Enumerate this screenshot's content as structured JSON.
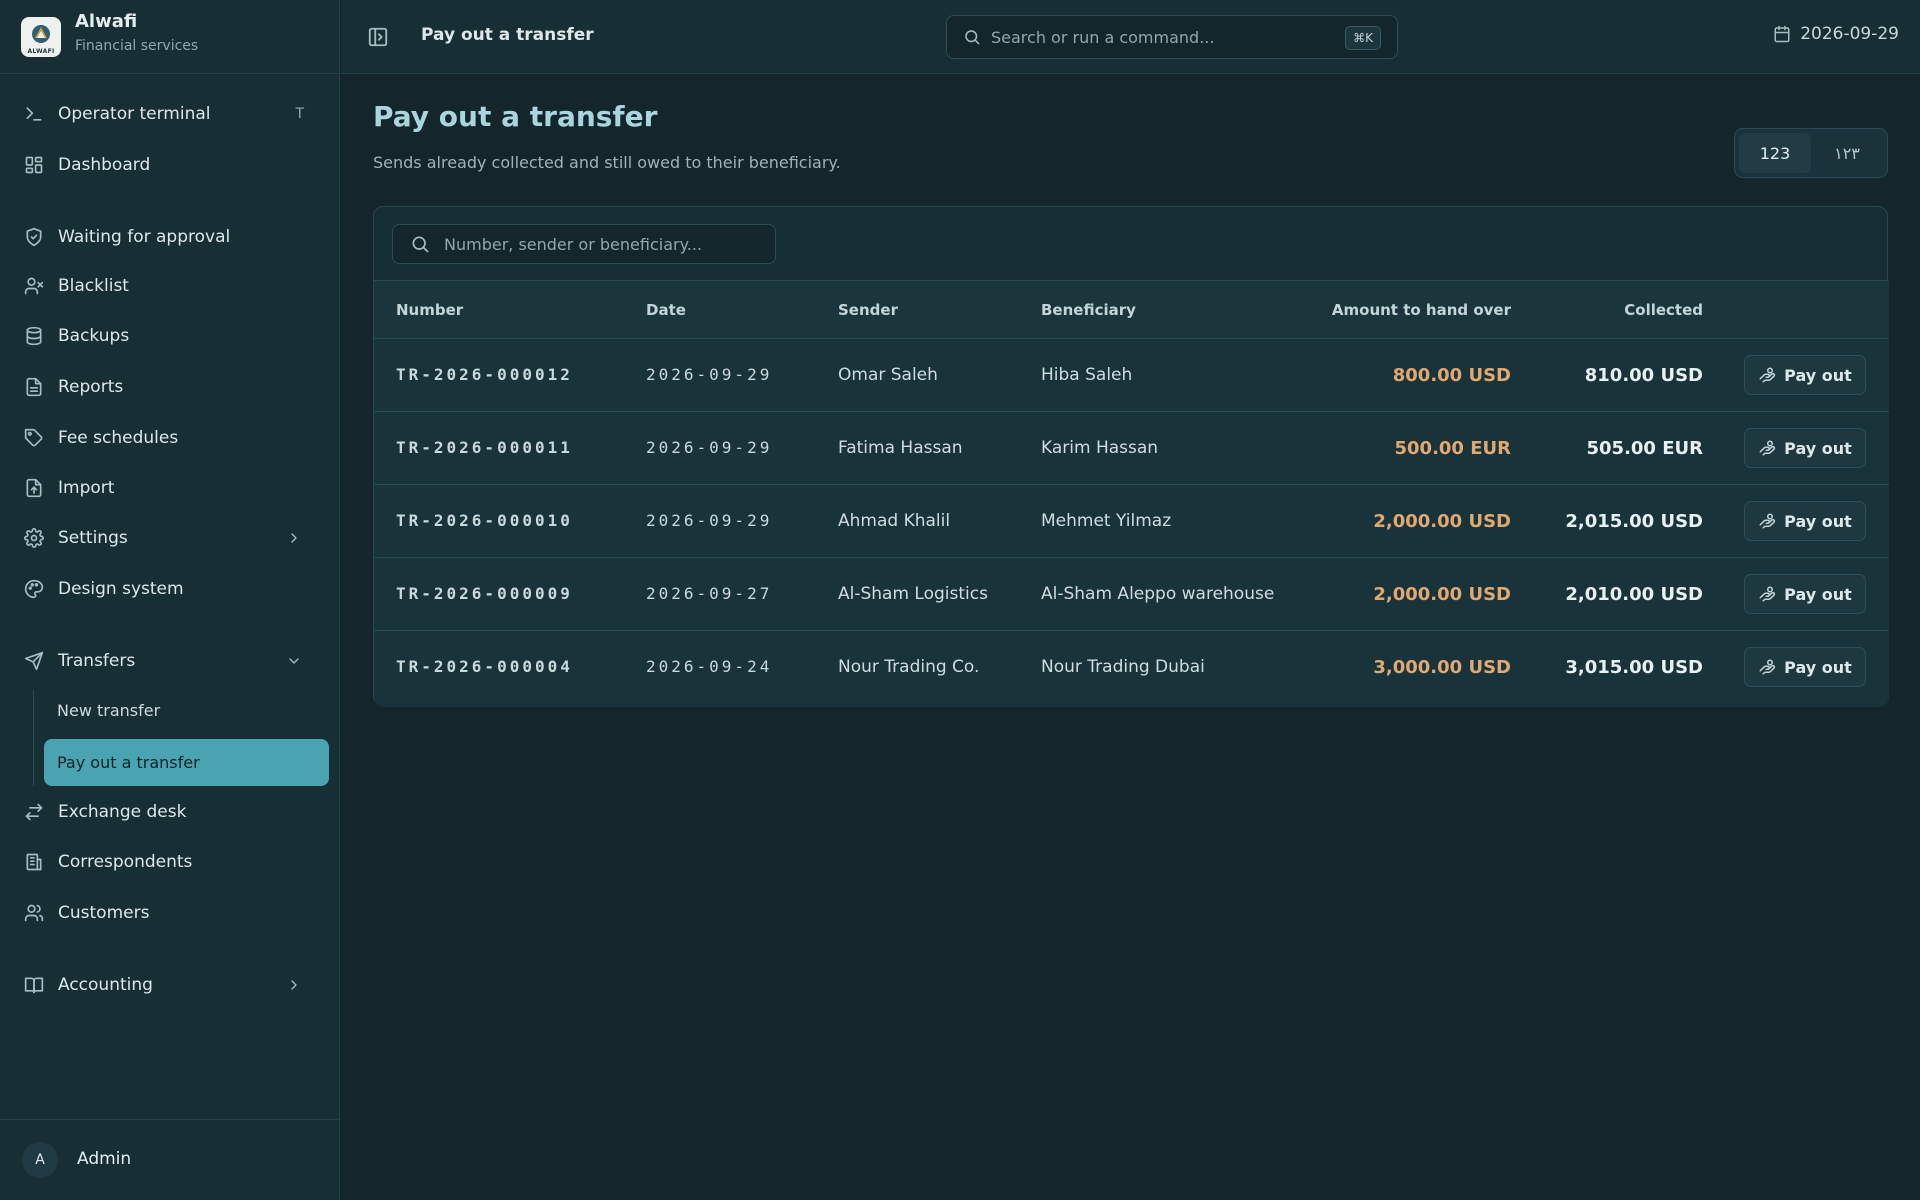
{
  "brand": {
    "name": "Alwafi",
    "subtitle": "Financial services",
    "logo_text": "ALWAFI"
  },
  "sidebar": {
    "items": [
      {
        "label": "Operator terminal",
        "icon": "terminal-icon",
        "shortcut": "T"
      },
      {
        "label": "Dashboard",
        "icon": "dashboard-icon"
      },
      {
        "label": "Waiting for approval",
        "icon": "shield-check-icon"
      },
      {
        "label": "Blacklist",
        "icon": "user-x-icon"
      },
      {
        "label": "Backups",
        "icon": "database-icon"
      },
      {
        "label": "Reports",
        "icon": "file-text-icon"
      },
      {
        "label": "Fee schedules",
        "icon": "tag-icon"
      },
      {
        "label": "Import",
        "icon": "file-import-icon"
      },
      {
        "label": "Settings",
        "icon": "gear-icon"
      },
      {
        "label": "Design system",
        "icon": "palette-icon"
      },
      {
        "label": "Transfers",
        "icon": "send-icon"
      },
      {
        "label": "Exchange desk",
        "icon": "arrows-exchange-icon"
      },
      {
        "label": "Correspondents",
        "icon": "building-icon"
      },
      {
        "label": "Customers",
        "icon": "users-icon"
      },
      {
        "label": "Accounting",
        "icon": "book-icon"
      }
    ],
    "transfers_sub": [
      {
        "label": "New transfer"
      },
      {
        "label": "Pay out a transfer",
        "active": true
      }
    ]
  },
  "user": {
    "initial": "A",
    "name": "Admin"
  },
  "topbar": {
    "title": "Pay out a transfer",
    "search_placeholder": "Search or run a command...",
    "shortcut": "⌘K",
    "date": "2026-09-29"
  },
  "page": {
    "title": "Pay out a transfer",
    "subtitle": "Sends already collected and still owed to their beneficiary.",
    "number_format": [
      "123",
      "١٢٣"
    ],
    "filter_placeholder": "Number, sender or beneficiary..."
  },
  "table": {
    "headers": {
      "number": "Number",
      "date": "Date",
      "sender": "Sender",
      "beneficiary": "Beneficiary",
      "amount": "Amount to hand over",
      "collected": "Collected"
    },
    "action_label": "Pay out",
    "rows": [
      {
        "number": "TR-2026-000012",
        "date": "2026-09-29",
        "sender": "Omar Saleh",
        "beneficiary": "Hiba Saleh",
        "amount": "800.00 USD",
        "collected": "810.00 USD"
      },
      {
        "number": "TR-2026-000011",
        "date": "2026-09-29",
        "sender": "Fatima Hassan",
        "beneficiary": "Karim Hassan",
        "amount": "500.00 EUR",
        "collected": "505.00 EUR"
      },
      {
        "number": "TR-2026-000010",
        "date": "2026-09-29",
        "sender": "Ahmad Khalil",
        "beneficiary": "Mehmet Yilmaz",
        "amount": "2,000.00 USD",
        "collected": "2,015.00 USD"
      },
      {
        "number": "TR-2026-000009",
        "date": "2026-09-27",
        "sender": "Al-Sham Logistics",
        "beneficiary": "Al-Sham Aleppo warehouse",
        "amount": "2,000.00 USD",
        "collected": "2,010.00 USD"
      },
      {
        "number": "TR-2026-000004",
        "date": "2026-09-24",
        "sender": "Nour Trading Co.",
        "beneficiary": "Nour Trading Dubai",
        "amount": "3,000.00 USD",
        "collected": "3,015.00 USD"
      }
    ]
  },
  "colors": {
    "background": "#14252b",
    "sidebar": "#172e35",
    "accent": "#4aa3b1",
    "amount": "#e2a871",
    "title": "#a9d6de"
  }
}
